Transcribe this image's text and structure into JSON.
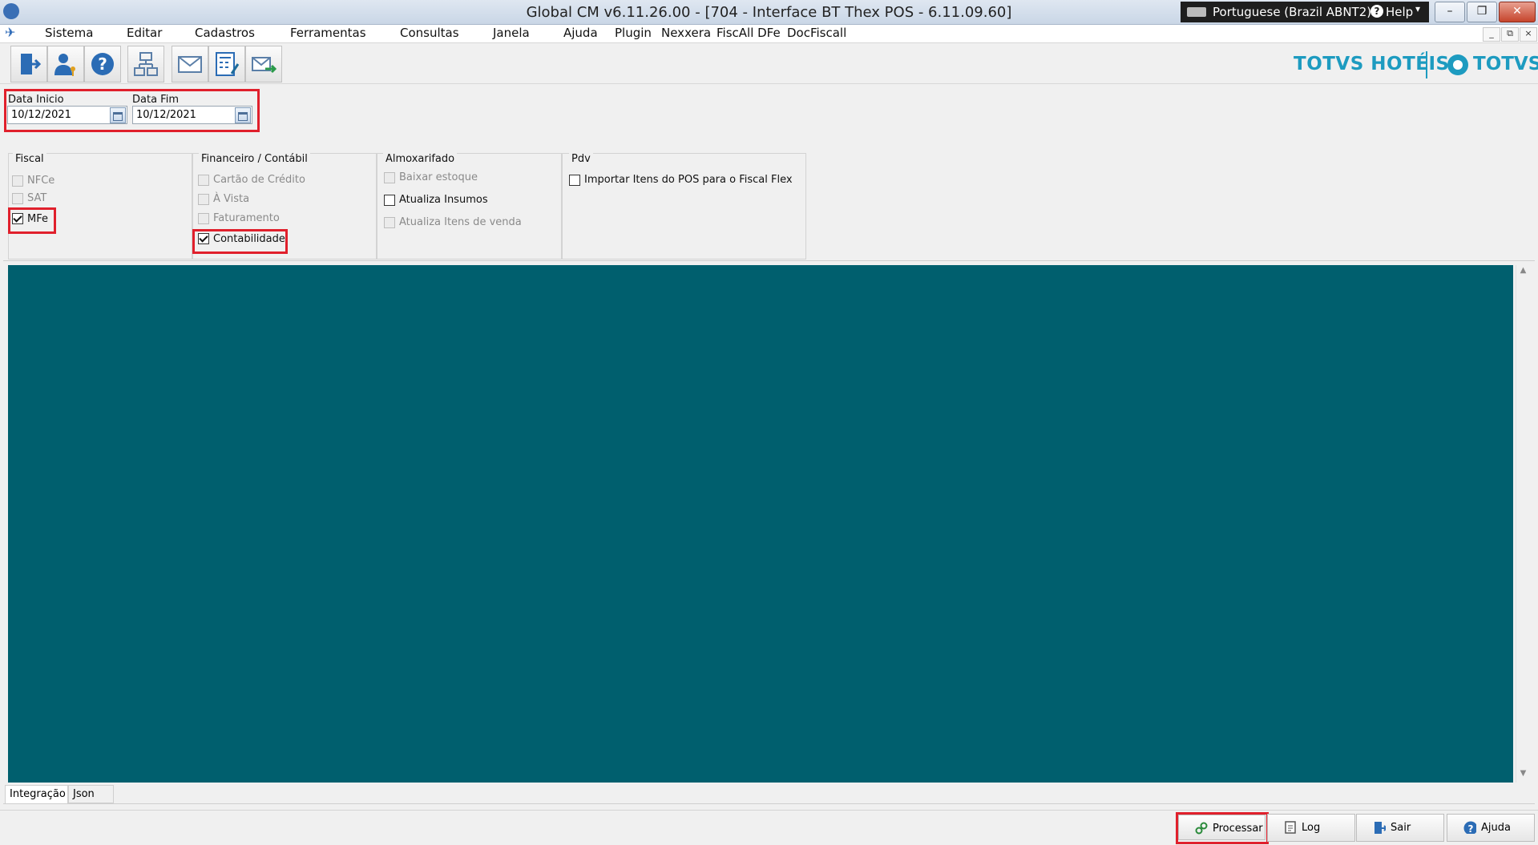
{
  "window": {
    "title": "Global CM v6.11.26.00 - [704 - Interface BT Thex POS - 6.11.09.60]",
    "language": "Portuguese (Brazil ABNT2)",
    "help": "Help",
    "minimize": "–",
    "restore": "❐",
    "close": "✕"
  },
  "menu": {
    "items": [
      "Sistema",
      "Editar",
      "Cadastros",
      "Ferramentas",
      "Consultas",
      "Janela",
      "Ajuda",
      "Plugin",
      "Nexxera",
      "FiscAll DFe",
      "DocFiscall"
    ],
    "mdi": [
      "_",
      "⧉",
      "×"
    ]
  },
  "toolbar": {
    "icons": [
      "exit-icon",
      "user-key-icon",
      "help-icon",
      "hierarchy-icon",
      "mail-icon",
      "calculator-edit-icon",
      "mail-send-icon"
    ]
  },
  "branding": {
    "product": "TOTVS HOTÉIS",
    "company": "TOTVS",
    "color": "#1d9bc0"
  },
  "dates": {
    "start_label": "Data Inicio",
    "start_value": "10/12/2021",
    "end_label": "Data Fim",
    "end_value": "10/12/2021"
  },
  "groups": {
    "fiscal": {
      "title": "Fiscal",
      "items": [
        {
          "label": "NFCe",
          "checked": false,
          "enabled": false
        },
        {
          "label": "SAT",
          "checked": false,
          "enabled": false
        },
        {
          "label": "MFe",
          "checked": true,
          "enabled": true
        }
      ]
    },
    "financeiro": {
      "title": "Financeiro / Contábil",
      "items": [
        {
          "label": "Cartão de Crédito",
          "checked": false,
          "enabled": false
        },
        {
          "label": "À Vista",
          "checked": false,
          "enabled": false
        },
        {
          "label": "Faturamento",
          "checked": false,
          "enabled": false
        },
        {
          "label": "Contabilidade",
          "checked": true,
          "enabled": true
        }
      ]
    },
    "almoxarifado": {
      "title": "Almoxarifado",
      "items": [
        {
          "label": "Baixar estoque",
          "checked": false,
          "enabled": false
        },
        {
          "label": "Atualiza Insumos",
          "checked": false,
          "enabled": true
        },
        {
          "label": "Atualiza Itens de venda",
          "checked": false,
          "enabled": false
        }
      ]
    },
    "pdv": {
      "title": "Pdv",
      "items": [
        {
          "label": "Importar Itens do POS para o Fiscal Flex",
          "checked": false,
          "enabled": true
        }
      ]
    }
  },
  "content": {
    "background": "#005f6e"
  },
  "tabs": [
    "Integração",
    "Json"
  ],
  "footer": {
    "process": "Processar",
    "log": "Log",
    "exit": "Sair",
    "help": "Ajuda"
  },
  "highlight_color": "#e0202c"
}
